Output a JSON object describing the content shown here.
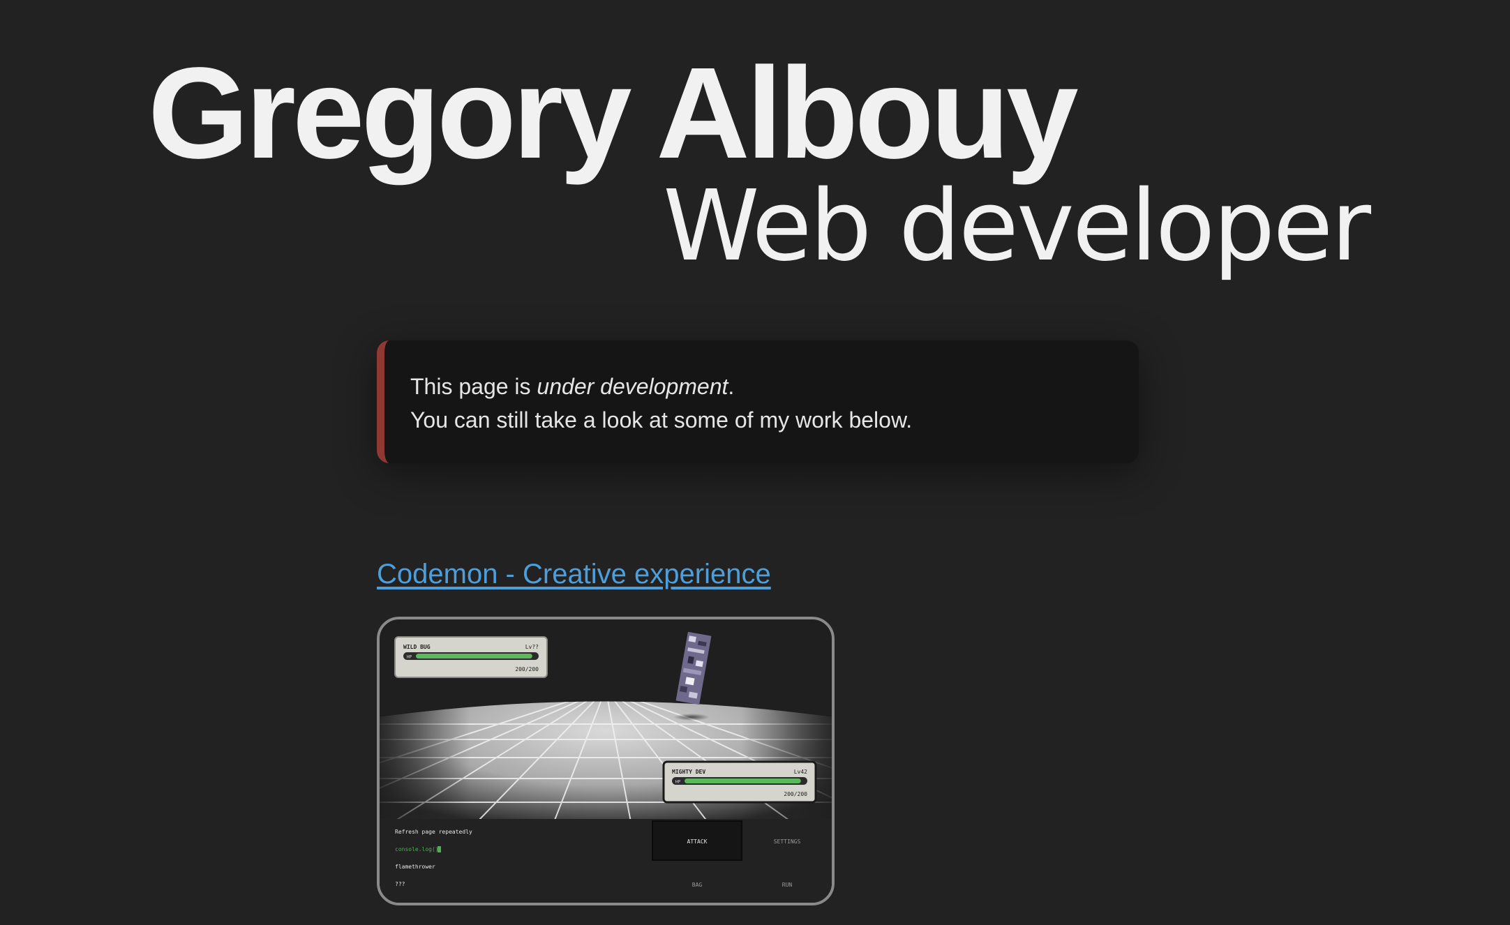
{
  "hero": {
    "name": "Gregory Albouy",
    "role": "Web developer"
  },
  "notice": {
    "line1_prefix": "This page is ",
    "line1_emphasis": "under development",
    "line1_suffix": ".",
    "line2": "You can still take a look at some of my work below."
  },
  "projects": [
    {
      "title": "Codemon - Creative experience",
      "preview": {
        "enemy": {
          "name": "WILD BUG",
          "level": "Lv??",
          "hp_label": "HP",
          "hp": "200/200",
          "hp_fraction": 0.97
        },
        "player": {
          "name": "MIGHTY DEV",
          "level": "Lv42",
          "hp_label": "HP",
          "hp": "200/200",
          "hp_fraction": 0.97
        },
        "log": [
          "Refresh page repeatedly",
          "console.log()",
          "flamethrower",
          "???"
        ],
        "menu": [
          "ATTACK",
          "SETTINGS",
          "BAG",
          "RUN"
        ]
      }
    }
  ],
  "colors": {
    "background": "#222222",
    "text": "#f1f1f1",
    "notice_bg": "#151515",
    "notice_accent": "#8e3a33",
    "link": "#4d9fdb",
    "hp_bar": "#5cb85c",
    "console_green": "#4caf50"
  }
}
